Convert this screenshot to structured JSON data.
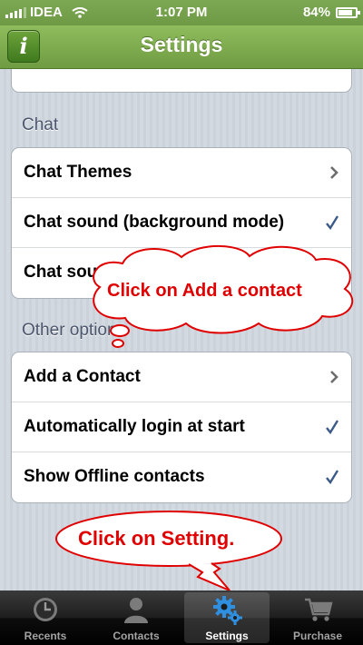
{
  "status_bar": {
    "carrier": "IDEA",
    "time": "1:07 PM",
    "battery_text": "84%",
    "battery_level": 0.84
  },
  "nav": {
    "title": "Settings",
    "info_icon_glyph": "i"
  },
  "chat_section": {
    "header": "Chat",
    "rows": [
      {
        "label": "Chat Themes",
        "accessory": "chevron"
      },
      {
        "label": "Chat sound (background mode)",
        "accessory": "checkmark"
      },
      {
        "label": "Chat sound (active session)",
        "accessory": "checkmark"
      }
    ]
  },
  "other_section": {
    "header": "Other options",
    "rows": [
      {
        "label": "Add a Contact",
        "accessory": "chevron"
      },
      {
        "label": "Automatically login at start",
        "accessory": "checkmark"
      },
      {
        "label": "Show Offline contacts",
        "accessory": "checkmark"
      }
    ]
  },
  "callouts": {
    "add_contact": "Click on Add a contact",
    "setting": "Click on Setting."
  },
  "tabs": [
    {
      "label": "Recents",
      "icon": "clock-icon",
      "active": false
    },
    {
      "label": "Contacts",
      "icon": "person-icon",
      "active": false
    },
    {
      "label": "Settings",
      "icon": "gears-icon",
      "active": true
    },
    {
      "label": "Purchase",
      "icon": "cart-icon",
      "active": false
    }
  ],
  "colors": {
    "nav_green": "#7aa84b",
    "accent_check": "#3b5a87",
    "callout_red": "#e00000",
    "section_header": "#4c566c"
  }
}
